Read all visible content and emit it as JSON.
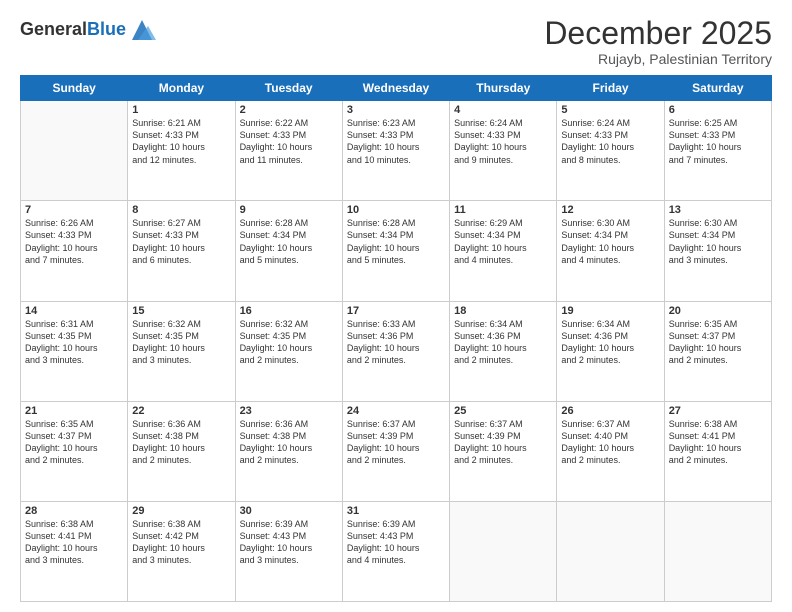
{
  "header": {
    "logo_general": "General",
    "logo_blue": "Blue",
    "month_title": "December 2025",
    "location": "Rujayb, Palestinian Territory"
  },
  "days_of_week": [
    "Sunday",
    "Monday",
    "Tuesday",
    "Wednesday",
    "Thursday",
    "Friday",
    "Saturday"
  ],
  "weeks": [
    [
      {
        "day": "",
        "info": ""
      },
      {
        "day": "1",
        "info": "Sunrise: 6:21 AM\nSunset: 4:33 PM\nDaylight: 10 hours\nand 12 minutes."
      },
      {
        "day": "2",
        "info": "Sunrise: 6:22 AM\nSunset: 4:33 PM\nDaylight: 10 hours\nand 11 minutes."
      },
      {
        "day": "3",
        "info": "Sunrise: 6:23 AM\nSunset: 4:33 PM\nDaylight: 10 hours\nand 10 minutes."
      },
      {
        "day": "4",
        "info": "Sunrise: 6:24 AM\nSunset: 4:33 PM\nDaylight: 10 hours\nand 9 minutes."
      },
      {
        "day": "5",
        "info": "Sunrise: 6:24 AM\nSunset: 4:33 PM\nDaylight: 10 hours\nand 8 minutes."
      },
      {
        "day": "6",
        "info": "Sunrise: 6:25 AM\nSunset: 4:33 PM\nDaylight: 10 hours\nand 7 minutes."
      }
    ],
    [
      {
        "day": "7",
        "info": "Sunrise: 6:26 AM\nSunset: 4:33 PM\nDaylight: 10 hours\nand 7 minutes."
      },
      {
        "day": "8",
        "info": "Sunrise: 6:27 AM\nSunset: 4:33 PM\nDaylight: 10 hours\nand 6 minutes."
      },
      {
        "day": "9",
        "info": "Sunrise: 6:28 AM\nSunset: 4:34 PM\nDaylight: 10 hours\nand 5 minutes."
      },
      {
        "day": "10",
        "info": "Sunrise: 6:28 AM\nSunset: 4:34 PM\nDaylight: 10 hours\nand 5 minutes."
      },
      {
        "day": "11",
        "info": "Sunrise: 6:29 AM\nSunset: 4:34 PM\nDaylight: 10 hours\nand 4 minutes."
      },
      {
        "day": "12",
        "info": "Sunrise: 6:30 AM\nSunset: 4:34 PM\nDaylight: 10 hours\nand 4 minutes."
      },
      {
        "day": "13",
        "info": "Sunrise: 6:30 AM\nSunset: 4:34 PM\nDaylight: 10 hours\nand 3 minutes."
      }
    ],
    [
      {
        "day": "14",
        "info": "Sunrise: 6:31 AM\nSunset: 4:35 PM\nDaylight: 10 hours\nand 3 minutes."
      },
      {
        "day": "15",
        "info": "Sunrise: 6:32 AM\nSunset: 4:35 PM\nDaylight: 10 hours\nand 3 minutes."
      },
      {
        "day": "16",
        "info": "Sunrise: 6:32 AM\nSunset: 4:35 PM\nDaylight: 10 hours\nand 2 minutes."
      },
      {
        "day": "17",
        "info": "Sunrise: 6:33 AM\nSunset: 4:36 PM\nDaylight: 10 hours\nand 2 minutes."
      },
      {
        "day": "18",
        "info": "Sunrise: 6:34 AM\nSunset: 4:36 PM\nDaylight: 10 hours\nand 2 minutes."
      },
      {
        "day": "19",
        "info": "Sunrise: 6:34 AM\nSunset: 4:36 PM\nDaylight: 10 hours\nand 2 minutes."
      },
      {
        "day": "20",
        "info": "Sunrise: 6:35 AM\nSunset: 4:37 PM\nDaylight: 10 hours\nand 2 minutes."
      }
    ],
    [
      {
        "day": "21",
        "info": "Sunrise: 6:35 AM\nSunset: 4:37 PM\nDaylight: 10 hours\nand 2 minutes."
      },
      {
        "day": "22",
        "info": "Sunrise: 6:36 AM\nSunset: 4:38 PM\nDaylight: 10 hours\nand 2 minutes."
      },
      {
        "day": "23",
        "info": "Sunrise: 6:36 AM\nSunset: 4:38 PM\nDaylight: 10 hours\nand 2 minutes."
      },
      {
        "day": "24",
        "info": "Sunrise: 6:37 AM\nSunset: 4:39 PM\nDaylight: 10 hours\nand 2 minutes."
      },
      {
        "day": "25",
        "info": "Sunrise: 6:37 AM\nSunset: 4:39 PM\nDaylight: 10 hours\nand 2 minutes."
      },
      {
        "day": "26",
        "info": "Sunrise: 6:37 AM\nSunset: 4:40 PM\nDaylight: 10 hours\nand 2 minutes."
      },
      {
        "day": "27",
        "info": "Sunrise: 6:38 AM\nSunset: 4:41 PM\nDaylight: 10 hours\nand 2 minutes."
      }
    ],
    [
      {
        "day": "28",
        "info": "Sunrise: 6:38 AM\nSunset: 4:41 PM\nDaylight: 10 hours\nand 3 minutes."
      },
      {
        "day": "29",
        "info": "Sunrise: 6:38 AM\nSunset: 4:42 PM\nDaylight: 10 hours\nand 3 minutes."
      },
      {
        "day": "30",
        "info": "Sunrise: 6:39 AM\nSunset: 4:43 PM\nDaylight: 10 hours\nand 3 minutes."
      },
      {
        "day": "31",
        "info": "Sunrise: 6:39 AM\nSunset: 4:43 PM\nDaylight: 10 hours\nand 4 minutes."
      },
      {
        "day": "",
        "info": ""
      },
      {
        "day": "",
        "info": ""
      },
      {
        "day": "",
        "info": ""
      }
    ]
  ]
}
